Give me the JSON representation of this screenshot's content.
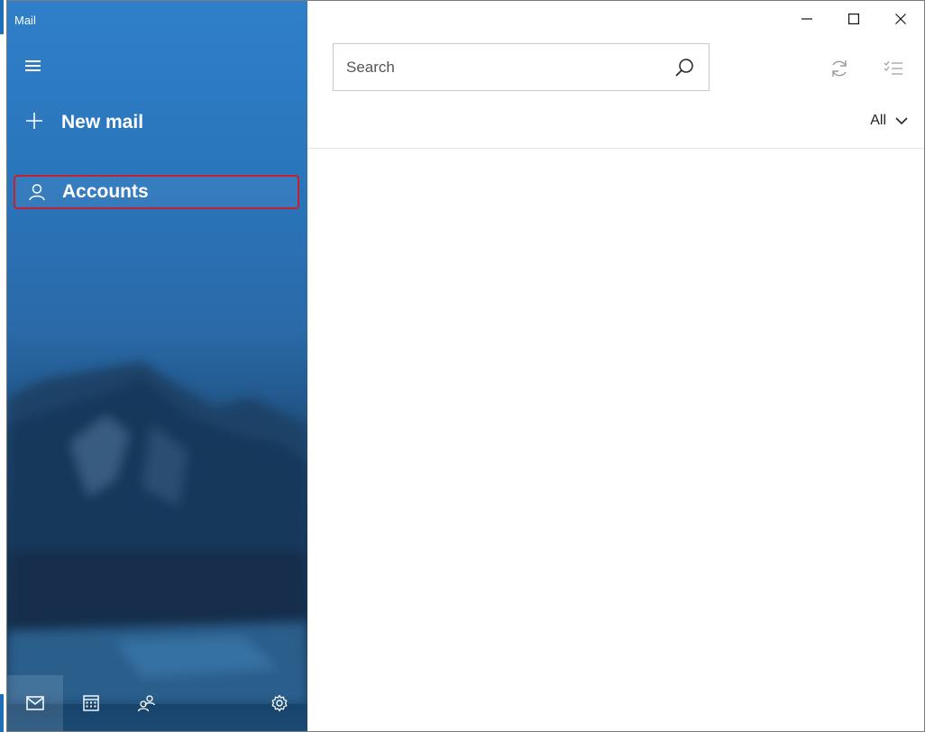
{
  "app": {
    "title": "Mail"
  },
  "sidebar": {
    "new_mail_label": "New mail",
    "accounts_label": "Accounts"
  },
  "search": {
    "placeholder": "Search",
    "value": ""
  },
  "filter": {
    "label": "All"
  },
  "bottom_nav": [
    {
      "id": "mail",
      "icon": "mail-icon",
      "active": true
    },
    {
      "id": "calendar",
      "icon": "calendar-icon",
      "active": false
    },
    {
      "id": "people",
      "icon": "people-icon",
      "active": false
    },
    {
      "id": "settings",
      "icon": "gear-icon",
      "active": false
    }
  ],
  "window_controls": [
    "minimize",
    "maximize",
    "close"
  ],
  "colors": {
    "sidebar_accent": "#2a75bb",
    "highlight_border": "#c81f2c"
  }
}
